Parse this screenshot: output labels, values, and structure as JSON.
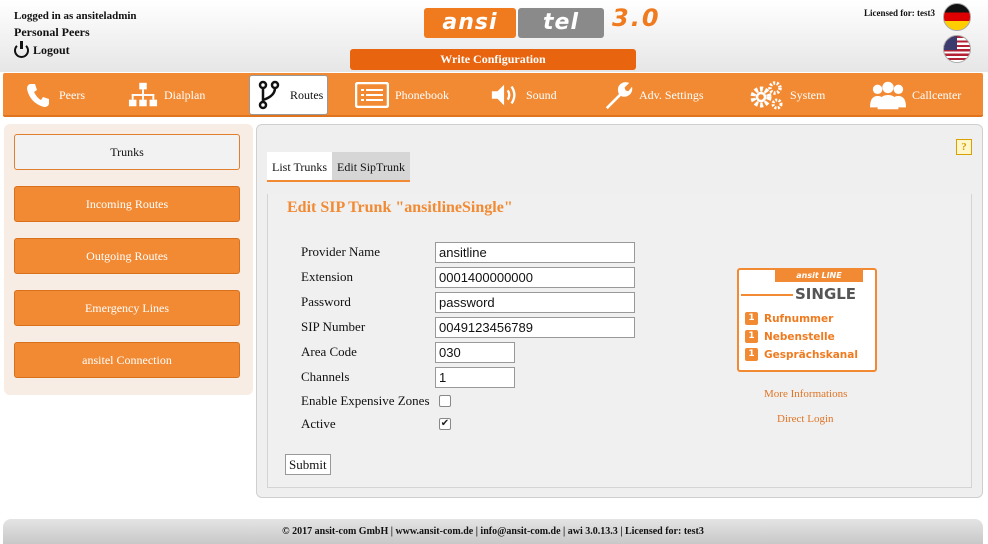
{
  "header": {
    "logged_in": "Logged in as ansiteladmin",
    "personal_peers": "Personal Peers",
    "logout": "Logout",
    "logo_ansi": "ansi",
    "logo_tel": "tel",
    "logo_version": "3.0",
    "write_configuration": "Write Configuration",
    "license": "Licensed for: test3"
  },
  "nav": [
    {
      "label": "Peers",
      "icon": "phone-icon"
    },
    {
      "label": "Dialplan",
      "icon": "hierarchy-icon"
    },
    {
      "label": "Routes",
      "icon": "routes-icon"
    },
    {
      "label": "Phonebook",
      "icon": "phonebook-icon"
    },
    {
      "label": "Sound",
      "icon": "speaker-icon"
    },
    {
      "label": "Adv. Settings",
      "icon": "wrench-icon"
    },
    {
      "label": "System",
      "icon": "gears-icon"
    },
    {
      "label": "Callcenter",
      "icon": "users-icon"
    }
  ],
  "sidebar": [
    {
      "label": "Trunks"
    },
    {
      "label": "Incoming Routes"
    },
    {
      "label": "Outgoing Routes"
    },
    {
      "label": "Emergency Lines"
    },
    {
      "label": "ansitel Connection"
    }
  ],
  "tabs": [
    "List Trunks",
    "Edit SipTrunk"
  ],
  "help_label": "?",
  "form": {
    "title": "Edit SIP Trunk \"ansitlineSingle\"",
    "provider_name_label": "Provider Name",
    "provider_name": "ansitline",
    "extension_label": "Extension",
    "extension": "0001400000000",
    "password_label": "Password",
    "password": "password",
    "sip_number_label": "SIP Number",
    "sip_number": "0049123456789",
    "area_code_label": "Area Code",
    "area_code": "030",
    "channels_label": "Channels",
    "channels": "1",
    "expensive_zones_label": "Enable Expensive Zones",
    "expensive_zones_checked": false,
    "active_label": "Active",
    "active_checked": true,
    "submit": "Submit"
  },
  "product": {
    "brand": "ansit LINE",
    "name": "SINGLE",
    "rows": [
      {
        "count": "1",
        "label": "Rufnummer"
      },
      {
        "count": "1",
        "label": "Nebenstelle"
      },
      {
        "count": "1",
        "label": "Gesprächskanal"
      }
    ],
    "more_info": "More Informations",
    "direct_login": "Direct Login"
  },
  "footer": "© 2017 ansit-com GmbH | www.ansit-com.de | info@ansit-com.de | awi 3.0.13.3 | Licensed for: test3"
}
